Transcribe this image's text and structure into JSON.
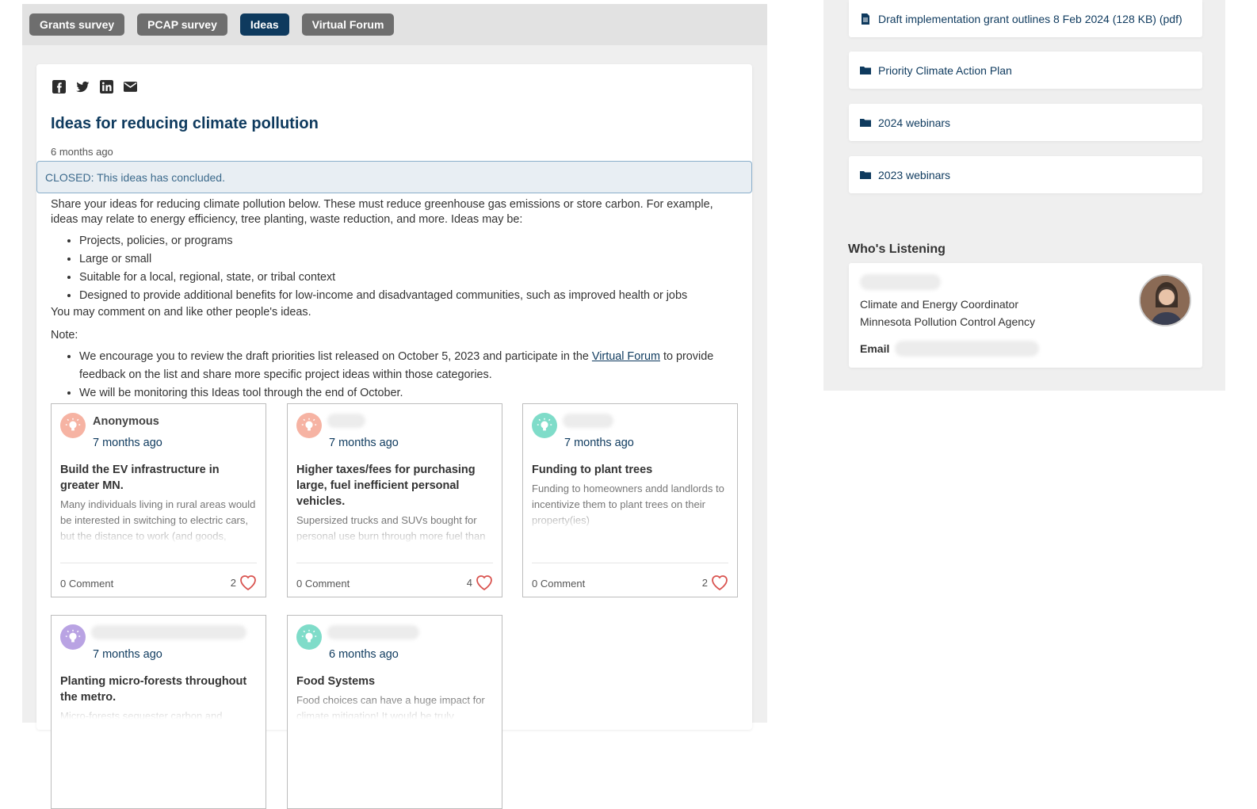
{
  "tabs": [
    {
      "label": "Grants survey",
      "active": false
    },
    {
      "label": "PCAP survey",
      "active": false
    },
    {
      "label": "Ideas",
      "active": true
    },
    {
      "label": "Virtual Forum",
      "active": false
    }
  ],
  "share_icons": [
    "facebook-icon",
    "twitter-icon",
    "linkedin-icon",
    "email-icon"
  ],
  "page": {
    "title": "Ideas for reducing climate pollution",
    "posted": "6 months ago",
    "closed_notice": "CLOSED: This ideas has concluded.",
    "intro": "Share your ideas for reducing climate pollution below. These must reduce greenhouse gas emissions or store carbon. For example, ideas may relate to energy efficiency, tree planting, waste reduction, and more. Ideas may be:",
    "bullets": [
      "Projects, policies, or programs",
      "Large or small",
      "Suitable for a local, regional, state, or tribal context",
      "Designed to provide additional benefits for low-income and disadvantaged communities, such as improved health or jobs"
    ],
    "comment_line": "You may comment on and like other people's ideas.",
    "note_label": "Note:",
    "note1_before": "We encourage you to review the draft priorities list released on October 5, 2023 and participate in the",
    "note1_link": "Virtual Forum",
    "note1_after": "to provide feedback on the list and share more specific project ideas within those categories.",
    "note2": "We will be monitoring this Ideas tool through the end of October."
  },
  "ideas": [
    {
      "author": "Anonymous",
      "time": "7 months ago",
      "title": "Build the EV infrastructure in greater MN.",
      "excerpt": "Many individuals living in rural areas would be interested in switching to electric cars, but the distance to work (and goods, services, etc.) makes that hard.",
      "comments": "0 Comment",
      "likes": "2",
      "avatar_color": "#f6b3a3"
    },
    {
      "author": "",
      "time": "7 months ago",
      "title": "Higher taxes/fees for purchasing large, fuel inefficient personal vehicles.",
      "excerpt": "Supersized trucks and SUVs bought for personal use burn through more fuel than needed.",
      "comments": "0 Comment",
      "likes": "4",
      "avatar_color": "#f6b3a3"
    },
    {
      "author": "",
      "time": "7 months ago",
      "title": "Funding to plant trees",
      "excerpt": "Funding to homeowners andd landlords to incentivize them to plant trees on their property(ies)",
      "comments": "0 Comment",
      "likes": "2",
      "avatar_color": "#7fdcc9"
    },
    {
      "author": "",
      "time": "7 months ago",
      "title": "Planting micro-forests throughout the metro.",
      "excerpt": "Micro-forests sequester carbon and",
      "comments": "",
      "likes": "",
      "avatar_color": "#b9a3e3"
    },
    {
      "author": "",
      "time": "6 months ago",
      "title": "Food Systems",
      "excerpt": "Food choices can have a huge impact for climate mitigation! It would be truly",
      "comments": "",
      "likes": "",
      "avatar_color": "#7fdcc9"
    }
  ],
  "sidebar": {
    "documents": [
      {
        "label": "Draft implementation grant outlines 8 Feb 2024 (128 KB) (pdf)",
        "icon": "document-icon"
      },
      {
        "label": "Priority Climate Action Plan",
        "icon": "folder-icon"
      },
      {
        "label": "2024 webinars",
        "icon": "folder-icon"
      },
      {
        "label": "2023 webinars",
        "icon": "folder-icon"
      }
    ],
    "listening_heading": "Who's Listening",
    "role": "Climate and Energy Coordinator",
    "org": "Minnesota Pollution Control Agency",
    "email_label": "Email"
  },
  "colors": {
    "brand": "#0e3a5e",
    "tab_inactive": "#6e6e6e",
    "heart": "#d9534f"
  }
}
